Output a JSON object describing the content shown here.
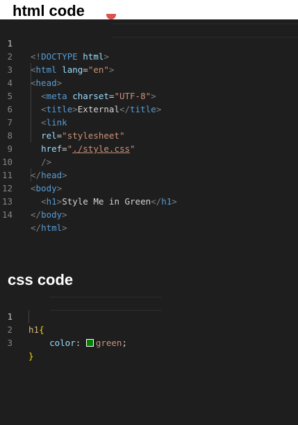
{
  "html_section": {
    "heading": "html code"
  },
  "css_section": {
    "heading": "css code"
  },
  "html_lines": [
    {
      "n": "1",
      "t": "<!DOCTYPE html>"
    },
    {
      "n": "2",
      "t": "<html lang=\"en\">"
    },
    {
      "n": "3",
      "t": "<head>"
    },
    {
      "n": "4",
      "t": "<meta charset=\"UTF-8\">"
    },
    {
      "n": "5",
      "t": "<title>External</title>"
    },
    {
      "n": "6",
      "t": "<link"
    },
    {
      "n": "7",
      "t": "rel=\"stylesheet\""
    },
    {
      "n": "8",
      "t": "href=\"./style.css\""
    },
    {
      "n": "9",
      "t": "/>"
    },
    {
      "n": "10",
      "t": "</head>"
    },
    {
      "n": "11",
      "t": "<body>"
    },
    {
      "n": "12",
      "t": "<h1>Style Me in Green</h1>"
    },
    {
      "n": "13",
      "t": "</body>"
    },
    {
      "n": "14",
      "t": "</html>"
    }
  ],
  "css_lines": [
    {
      "n": "1",
      "t": "h1{"
    },
    {
      "n": "2",
      "t": "color: green;"
    },
    {
      "n": "3",
      "t": "}"
    }
  ],
  "colors": {
    "background": "#1e1e1e",
    "tag": "#569cd6",
    "attribute": "#9cdcfe",
    "string": "#ce9178",
    "text": "#d4d4d4",
    "selector": "#d7ba7d",
    "brace": "#ffd700",
    "swatch_green": "#008000"
  }
}
